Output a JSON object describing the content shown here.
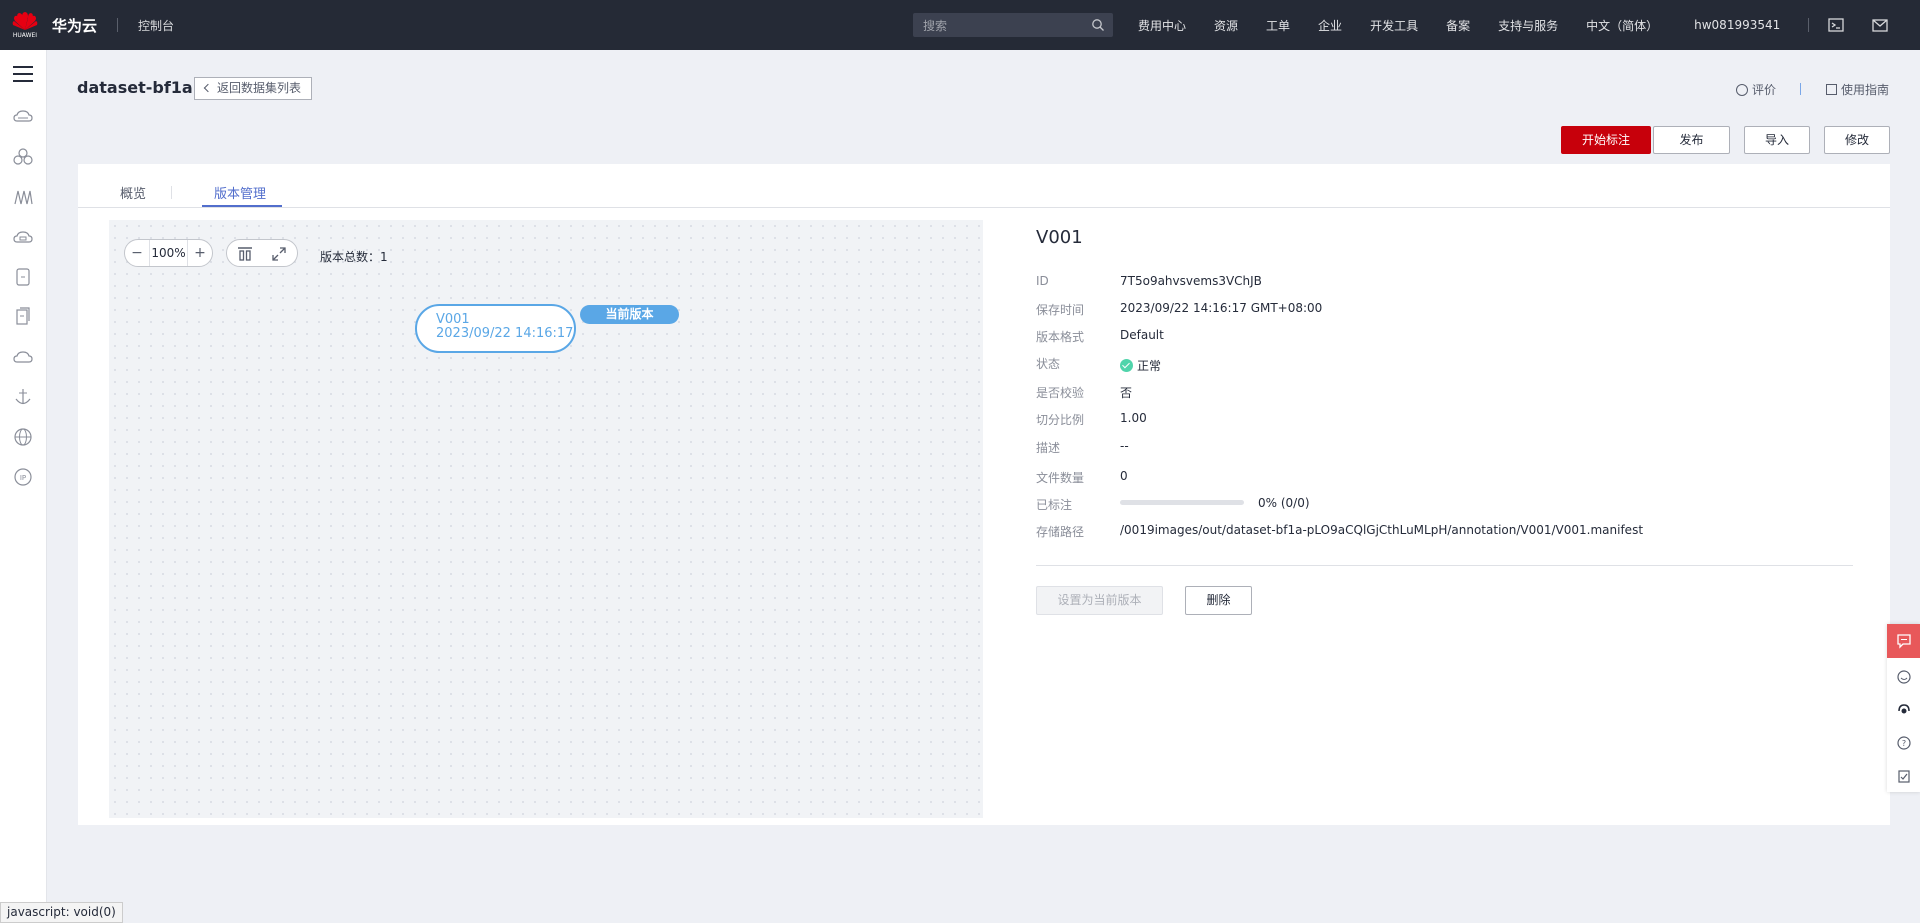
{
  "topbar": {
    "logo_text": "HUAWEI",
    "brand": "华为云",
    "console": "控制台",
    "search_placeholder": "搜索",
    "nav": [
      "费用中心",
      "资源",
      "工单",
      "企业",
      "开发工具",
      "备案",
      "支持与服务",
      "中文（简体）"
    ],
    "user": "hw081993541"
  },
  "header": {
    "title": "dataset-bf1a",
    "back_label": "返回数据集列表",
    "rate_label": "评价",
    "guide_label": "使用指南"
  },
  "actions": {
    "start_label": "开始标注",
    "publish_label": "发布",
    "import_label": "导入",
    "edit_label": "修改"
  },
  "tabs": {
    "overview": "概览",
    "versions": "版本管理"
  },
  "canvas": {
    "zoom_minus": "−",
    "zoom_value": "100%",
    "zoom_plus": "+",
    "version_count": "版本总数：1",
    "node_name": "V001",
    "node_time": "2023/09/22 14:16:17",
    "current_badge": "当前版本"
  },
  "detail": {
    "title": "V001",
    "fields": {
      "id": {
        "label": "ID",
        "value": "7T5o9ahvsvems3VChJB"
      },
      "saved": {
        "label": "保存时间",
        "value": "2023/09/22 14:16:17 GMT+08:00"
      },
      "format": {
        "label": "版本格式",
        "value": "Default"
      },
      "status": {
        "label": "状态",
        "value": "正常"
      },
      "verify": {
        "label": "是否校验",
        "value": "否"
      },
      "ratio": {
        "label": "切分比例",
        "value": "1.00"
      },
      "desc": {
        "label": "描述",
        "value": "--"
      },
      "files": {
        "label": "文件数量",
        "value": "0"
      },
      "labeled": {
        "label": "已标注",
        "value": "0% (0/0)",
        "progress": 0
      },
      "path": {
        "label": "存储路径",
        "value": "/0019images/out/dataset-bf1a-pLO9aCQlGjCthLuMLpH/annotation/V001/V001.manifest"
      }
    },
    "set_current_label": "设置为当前版本",
    "delete_label": "删除"
  },
  "statusbar": "javascript: void(0)",
  "colors": {
    "topbar": "#252a36",
    "primary_red": "#c7000b",
    "accent_blue": "#526ecc",
    "node_blue": "#5aa7e6",
    "status_green": "#50d4ab",
    "float_red": "#e8585a"
  }
}
